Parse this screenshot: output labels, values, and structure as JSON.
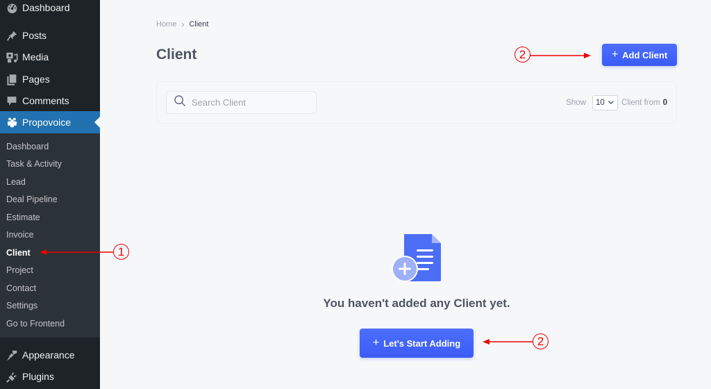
{
  "sidebar": {
    "top_items": [
      {
        "label": "Dashboard",
        "icon": "dashboard-icon"
      },
      {
        "label": "Posts",
        "icon": "pin-icon"
      },
      {
        "label": "Media",
        "icon": "media-icon"
      },
      {
        "label": "Pages",
        "icon": "pages-icon"
      },
      {
        "label": "Comments",
        "icon": "comment-icon"
      },
      {
        "label": "Propovoice",
        "icon": "users-icon",
        "active": true
      }
    ],
    "submenu": [
      {
        "label": "Dashboard"
      },
      {
        "label": "Task & Activity"
      },
      {
        "label": "Lead"
      },
      {
        "label": "Deal Pipeline"
      },
      {
        "label": "Estimate"
      },
      {
        "label": "Invoice"
      },
      {
        "label": "Client",
        "current": true
      },
      {
        "label": "Project"
      },
      {
        "label": "Contact"
      },
      {
        "label": "Settings"
      },
      {
        "label": "Go to Frontend"
      }
    ],
    "bottom_items": [
      {
        "label": "Appearance",
        "icon": "brush-icon"
      },
      {
        "label": "Plugins",
        "icon": "plugin-icon"
      }
    ]
  },
  "breadcrumb": {
    "home": "Home",
    "separator": "›",
    "current": "Client"
  },
  "page": {
    "title": "Client",
    "add_button": {
      "plus": "+",
      "label": "Add Client"
    }
  },
  "filter": {
    "search_placeholder": "Search Client",
    "search_value": "",
    "show_label": "Show",
    "per_page": "10",
    "from_label": "Client from",
    "count": "0"
  },
  "empty_state": {
    "message": "You haven't added any Client yet.",
    "button": {
      "plus": "+",
      "label": "Let's Start Adding"
    }
  },
  "annotations": [
    {
      "number": "1",
      "target": "sidebar Client"
    },
    {
      "number": "2",
      "target": "Add Client button"
    },
    {
      "number": "2",
      "target": "Let's Start Adding button"
    }
  ],
  "colors": {
    "primary": "#4263fa",
    "sidebar_bg": "#1d2327",
    "submenu_bg": "#2c3338",
    "active_bg": "#2271b1",
    "annotation": "#e00000"
  }
}
